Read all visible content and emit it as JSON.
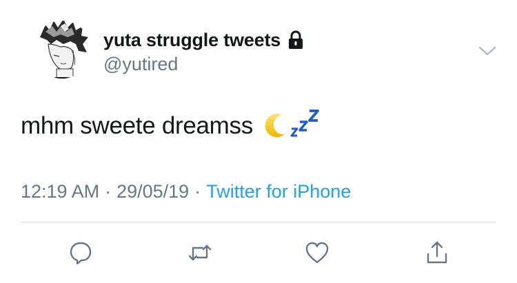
{
  "tweet": {
    "display_name": "yuta struggle tweets",
    "handle": "@yutired",
    "protected_icon": "lock-icon",
    "text": "mhm sweete dreamss",
    "emojis": [
      "crescent-moon-icon",
      "zzz-icon"
    ],
    "time": "12:19 AM",
    "date": "29/05/19",
    "separator": "·",
    "source": "Twitter for iPhone"
  },
  "actions": [
    {
      "name": "reply",
      "icon": "reply-icon"
    },
    {
      "name": "retweet",
      "icon": "retweet-icon"
    },
    {
      "name": "like",
      "icon": "heart-icon"
    },
    {
      "name": "share",
      "icon": "share-icon"
    }
  ],
  "colors": {
    "text_primary": "#14171a",
    "text_secondary": "#657786",
    "link": "#1da1f2",
    "divider": "#ccd6dd",
    "zzz": "#1c5ccf"
  }
}
